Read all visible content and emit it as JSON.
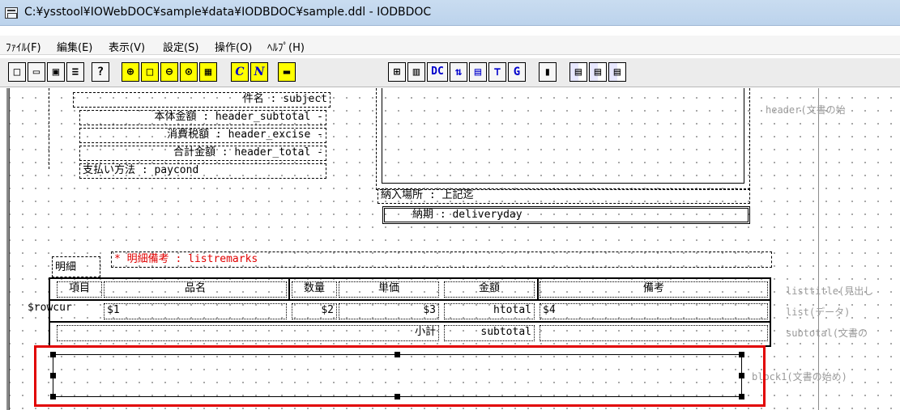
{
  "window": {
    "title": "C:¥ysstool¥IOWebDOC¥sample¥data¥IODBDOC¥sample.ddl - IODBDOC",
    "icon": "app-window-icon"
  },
  "menu": [
    "ﾌｧｲﾙ(F)",
    "編集(E)",
    "表示(V)",
    "設定(S)",
    "操作(O)",
    "ﾍﾙﾌﾟ(H)"
  ],
  "toolbar": {
    "dc_label": "DC",
    "g_label": "G",
    "c_label": "C",
    "n_label": "N",
    "help_label": "?",
    "icons": [
      "new-file-icon",
      "open-folder-icon",
      "save-icon",
      "document-icon",
      "help-icon",
      "zoom-in-icon",
      "rectangle-icon",
      "zoom-out-icon",
      "zoom-fit-icon",
      "grid-icon",
      "c-icon",
      "n-icon",
      "highlight-icon",
      "table-insert-icon",
      "columns-icon",
      "dc-icon",
      "sort-icon",
      "image-icon",
      "tree-icon",
      "g-icon",
      "bars-icon",
      "layout-icon-1",
      "layout-icon-2",
      "layout-icon-3"
    ]
  },
  "header": {
    "fields": [
      "件名 : subject",
      "本体金額 : header_subtotal -",
      "消費税額 : header_excise -",
      "合計金額 : header_total -",
      "支払い方法 : paycond"
    ],
    "delivery_place": "納入場所 : 上記迄",
    "delivery_day": "納期 : deliveryday"
  },
  "list": {
    "remark": "* 明細備考 : listremarks",
    "title_label": "明細",
    "headers": [
      "項目",
      "品名",
      "数量",
      "単価",
      "金額",
      "備考"
    ],
    "row": [
      "$rowcur",
      "$1",
      "$2",
      "$3",
      "htotal",
      "$4"
    ],
    "subtotal_label": "小計",
    "subtotal_value": "subtotal"
  },
  "sections": {
    "header": "header(文書の始",
    "listtitle": "listtitle(見出し",
    "list": "list(データ)",
    "subtotal": "subtotal(文書の",
    "block": "block1(文書の始め)"
  },
  "colors": {
    "selection_frame": "#e10000",
    "remark_text": "#e00000",
    "titlebar": "#bcd3ec"
  }
}
